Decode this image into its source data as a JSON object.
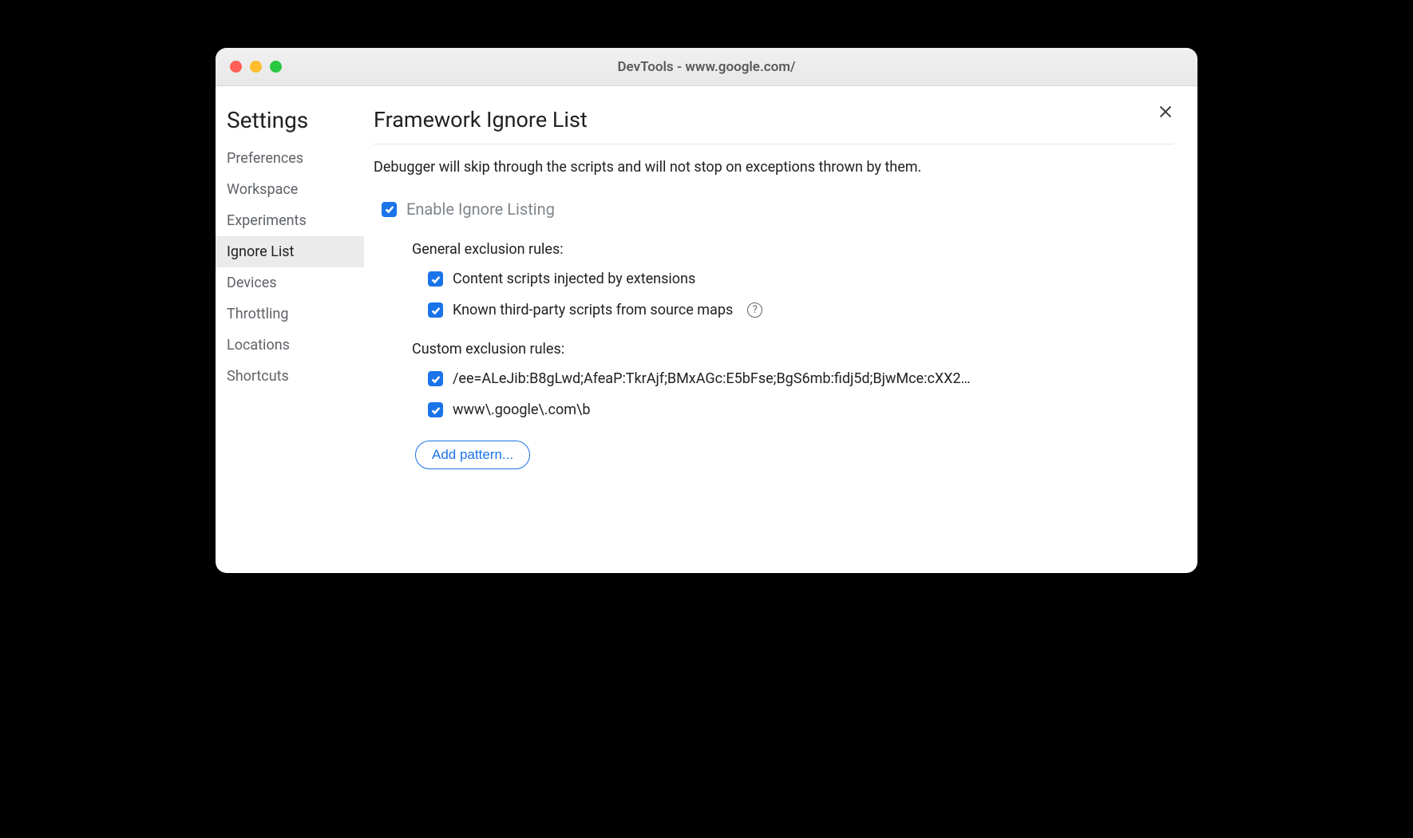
{
  "window": {
    "title": "DevTools - www.google.com/"
  },
  "sidebar": {
    "title": "Settings",
    "items": [
      {
        "label": "Preferences",
        "selected": false
      },
      {
        "label": "Workspace",
        "selected": false
      },
      {
        "label": "Experiments",
        "selected": false
      },
      {
        "label": "Ignore List",
        "selected": true
      },
      {
        "label": "Devices",
        "selected": false
      },
      {
        "label": "Throttling",
        "selected": false
      },
      {
        "label": "Locations",
        "selected": false
      },
      {
        "label": "Shortcuts",
        "selected": false
      }
    ]
  },
  "main": {
    "title": "Framework Ignore List",
    "description": "Debugger will skip through the scripts and will not stop on exceptions thrown by them.",
    "enable_label": "Enable Ignore Listing",
    "enable_checked": true,
    "general_heading": "General exclusion rules:",
    "general_rules": [
      {
        "label": "Content scripts injected by extensions",
        "checked": true,
        "help": false
      },
      {
        "label": "Known third-party scripts from source maps",
        "checked": true,
        "help": true
      }
    ],
    "custom_heading": "Custom exclusion rules:",
    "custom_rules": [
      {
        "label": "/ee=ALeJib:B8gLwd;AfeaP:TkrAjf;BMxAGc:E5bFse;BgS6mb:fidj5d;BjwMce:cXX2…",
        "checked": true
      },
      {
        "label": "www\\.google\\.com\\b",
        "checked": true
      }
    ],
    "add_pattern_label": "Add pattern..."
  }
}
